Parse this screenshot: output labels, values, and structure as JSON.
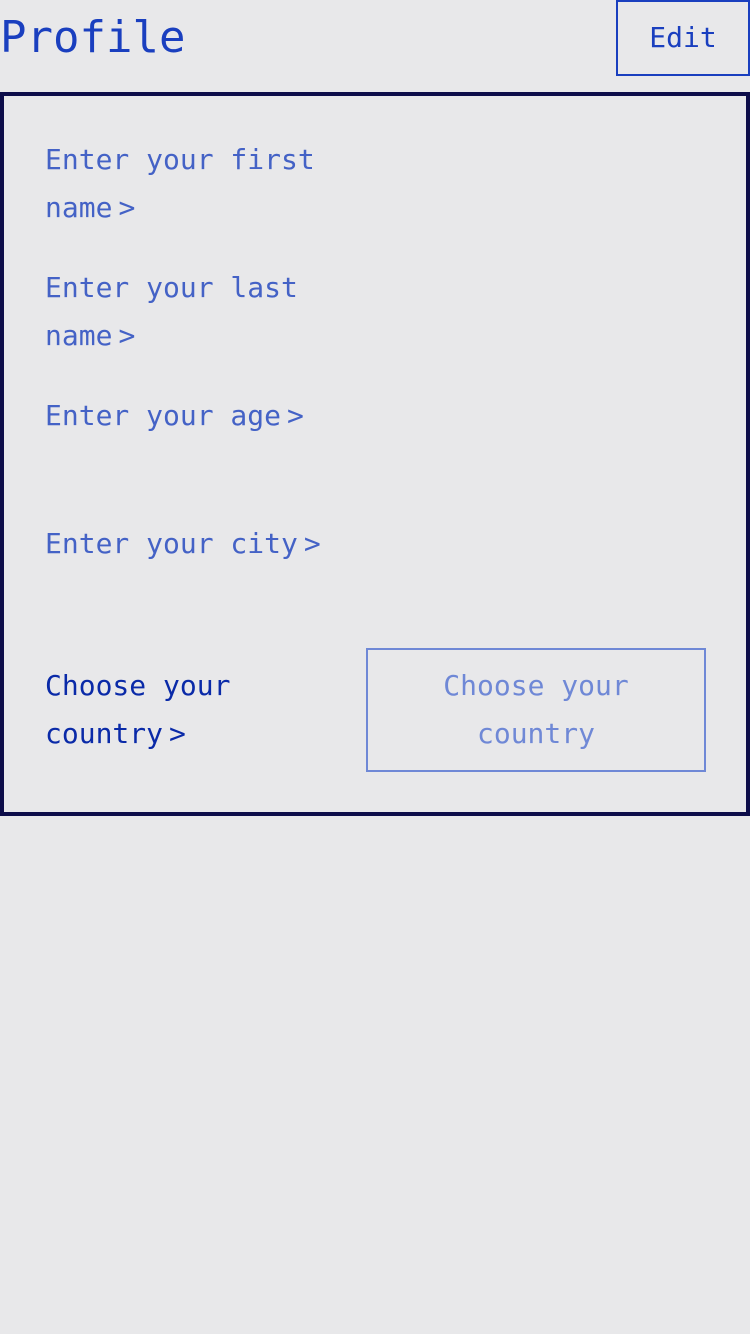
{
  "header": {
    "title": "Profile",
    "edit_label": "Edit"
  },
  "form": {
    "first_name": {
      "label": "Enter your first name",
      "chevron": ">"
    },
    "last_name": {
      "label": "Enter your last name",
      "chevron": ">"
    },
    "age": {
      "label": "Enter your age",
      "chevron": ">"
    },
    "city": {
      "label": "Enter your city",
      "chevron": ">"
    },
    "country": {
      "label": "Choose your country",
      "chevron": ">",
      "select_line1": "Choose your",
      "select_line2": "country"
    }
  },
  "colors": {
    "background": "#e8e8ea",
    "accent": "#1a3fbf",
    "field_text": "#4462c6",
    "card_border": "#0d0d4a",
    "placeholder": "#6f88d6"
  }
}
